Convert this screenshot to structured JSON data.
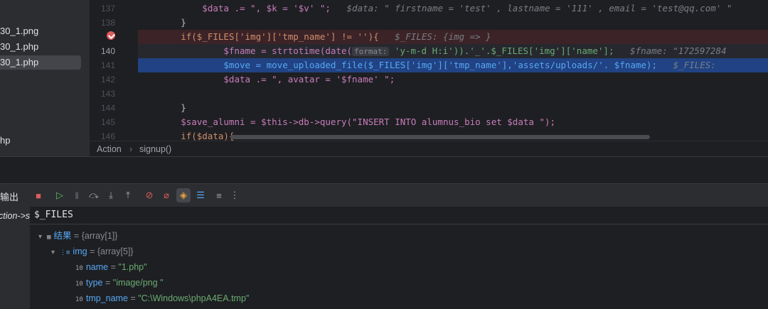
{
  "project_tree": {
    "items": [
      {
        "label": "30_1.png",
        "selected": false
      },
      {
        "label": "30_1.php",
        "selected": false
      },
      {
        "label": "30_1.php",
        "selected": true
      },
      {
        "label": "hp",
        "selected": false
      }
    ]
  },
  "editor": {
    "line_numbers": [
      "137",
      "138",
      "",
      "140",
      "141",
      "142",
      "143",
      "144",
      "145",
      "146"
    ],
    "current_line": "140",
    "lines": [
      {
        "code": "            $data .= \", $k = '$v' \";",
        "hint": "$data: \" firstname = 'test' , lastname = '111' , email = 'test@qq.com' \""
      },
      {
        "code": "        }",
        "hint": ""
      },
      {
        "code": "        if($_FILES['img']['tmp_name'] != ''){",
        "hint": "$_FILES: {img => }"
      },
      {
        "code_pre": "                $fname = strtotime(date(",
        "inlay": "format:",
        "code_post": " 'y-m-d H:i')).'_'.$_FILES['img']['name'];",
        "hint": "$fname: \"172597284"
      },
      {
        "code": "                $move = move_uploaded_file($_FILES['img']['tmp_name'],'assets/uploads/'. $fname);",
        "hint": "$_FILES:"
      },
      {
        "code": "                $data .= \", avatar = '$fname' \";",
        "hint": ""
      },
      {
        "code": "",
        "hint": ""
      },
      {
        "code": "        }",
        "hint": ""
      },
      {
        "code": "        $save_alumni = $this->db->query(\"INSERT INTO alumnus_bio set $data \");",
        "hint": ""
      },
      {
        "code": "        if($data){",
        "hint": ""
      }
    ]
  },
  "breadcrumb": {
    "items": [
      "Action",
      "signup()"
    ]
  },
  "debug_toolbar": {
    "tab_label": "输出",
    "buttons": [
      "stop-icon",
      "resume-icon",
      "pause-icon",
      "step-over-icon",
      "step-into-icon",
      "step-out-icon",
      "view-breakpoints-icon",
      "mute-breakpoints-icon",
      "evaluate-icon",
      "frames-icon",
      "add-watch-icon",
      "more-icon"
    ]
  },
  "frames": {
    "item": "ction->s"
  },
  "variables": {
    "eval_expression": "$_FILES",
    "rows": [
      {
        "name": "结果",
        "value": "{array[1]}",
        "kind": "array",
        "depth": 0,
        "expanded": true
      },
      {
        "name": "img",
        "value": "{array[5]}",
        "kind": "array",
        "depth": 1,
        "expanded": true
      },
      {
        "name": "name",
        "value": "\"1.php\"",
        "kind": "string",
        "depth": 2
      },
      {
        "name": "type",
        "value": "\"image/png  \"",
        "kind": "string",
        "depth": 2
      },
      {
        "name": "tmp_name",
        "value": "\"C:\\Windows\\phpA4EA.tmp\"",
        "kind": "string",
        "depth": 2
      }
    ]
  },
  "colors": {
    "breakpoint_line": "#3b2327",
    "execution_line": "#214283",
    "string": "#6aab73",
    "variable": "#c77dbb",
    "function": "#56a8f5"
  }
}
